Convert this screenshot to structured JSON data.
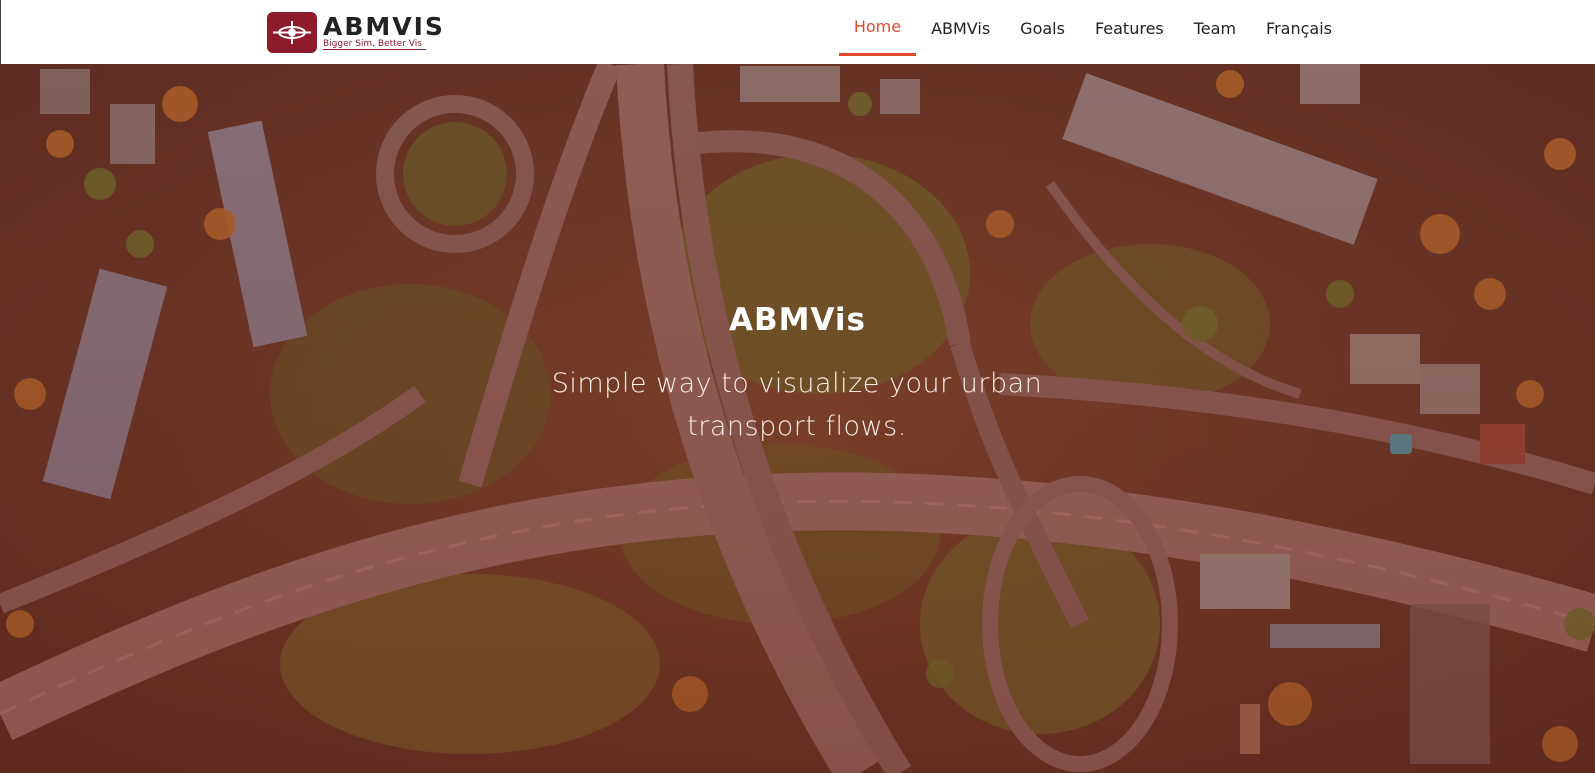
{
  "brand": {
    "name": "ABMVIS",
    "tagline": "Bigger Sim, Better Vis",
    "color": "#8e1b2b"
  },
  "nav": {
    "items": [
      {
        "label": "Home",
        "active": true
      },
      {
        "label": "ABMVis",
        "active": false
      },
      {
        "label": "Goals",
        "active": false
      },
      {
        "label": "Features",
        "active": false
      },
      {
        "label": "Team",
        "active": false
      },
      {
        "label": "Français",
        "active": false
      }
    ],
    "active_color": "#e04b2c"
  },
  "hero": {
    "title": "ABMVis",
    "subtitle": "Simple way to visualize your urban transport flows."
  }
}
